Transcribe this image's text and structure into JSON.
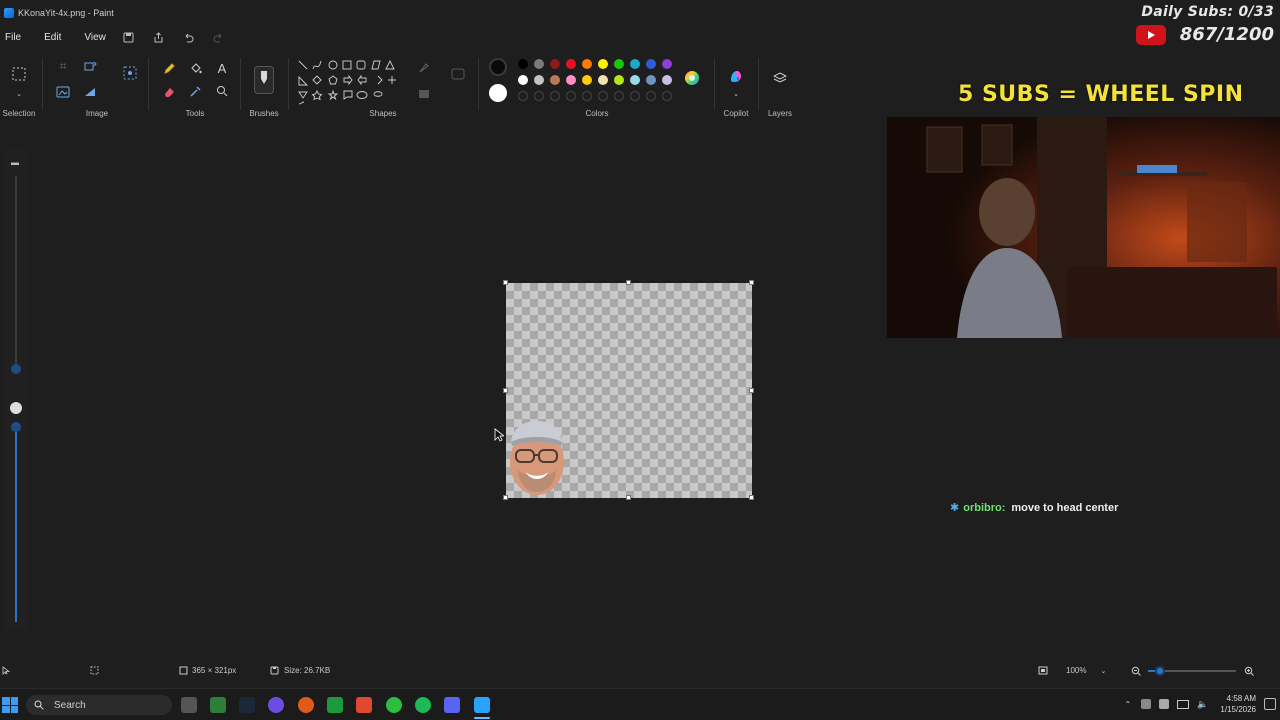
{
  "window": {
    "title": "KKonaYit-4x.png - Paint"
  },
  "menu": {
    "file": "File",
    "edit": "Edit",
    "view": "View"
  },
  "ribbon": {
    "groups": {
      "selection": "Selection",
      "image": "Image",
      "tools": "Tools",
      "brushes": "Brushes",
      "shapes": "Shapes",
      "colors": "Colors",
      "copilot": "Copilot",
      "layers": "Layers"
    },
    "palette_row1": [
      "#000000",
      "#7a7a7a",
      "#8b1a1a",
      "#e81123",
      "#ff7a00",
      "#fff100",
      "#16c60c",
      "#1ea7c9",
      "#2b5fd9",
      "#8e3fd1"
    ],
    "palette_row2": [
      "#ffffff",
      "#c3c3c3",
      "#b97a57",
      "#ff8ec6",
      "#ffc90e",
      "#efe4b0",
      "#b5e61d",
      "#99d9ea",
      "#7092be",
      "#c8bfe7"
    ],
    "primary_color": "#000000",
    "secondary_color": "#ffffff"
  },
  "overlay": {
    "daily_subs": "Daily Subs: 0/33",
    "sub_count": "867/1200",
    "wheel_text": "5 SUBS = WHEEL SPIN",
    "chat_user": "orbibro:",
    "chat_message": "move to head center"
  },
  "status": {
    "dimensions": "365 × 321px",
    "size": "Size: 26.7KB",
    "zoom": "100%"
  },
  "taskbar": {
    "search_placeholder": "Search",
    "time": "4:58 AM",
    "date": "1/15/2026"
  }
}
